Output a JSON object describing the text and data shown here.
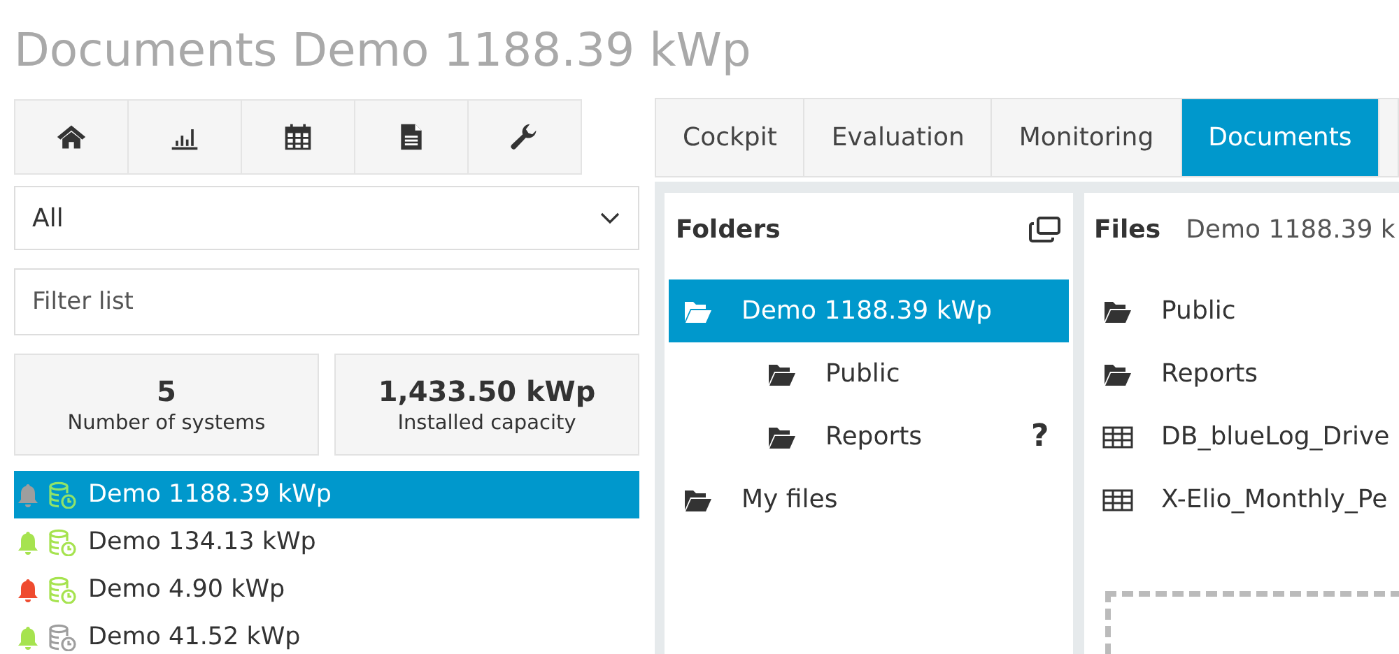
{
  "page_title": "Documents Demo 1188.39 kWp",
  "toolbar": [
    {
      "kind": "home",
      "selected": false
    },
    {
      "kind": "chart",
      "selected": false
    },
    {
      "kind": "calendar",
      "selected": false
    },
    {
      "kind": "document",
      "selected": false
    },
    {
      "kind": "wrench",
      "selected": false
    }
  ],
  "filter_select": {
    "value": "All"
  },
  "filter_input": {
    "placeholder": "Filter list"
  },
  "stats": [
    {
      "value": "5",
      "label": "Number of systems"
    },
    {
      "value": "1,433.50 kWp",
      "label": "Installed capacity"
    }
  ],
  "systems": [
    {
      "name": "Demo 1188.39 kWp",
      "selected": true,
      "alarm": {
        "color": "#9e9e9e"
      },
      "data": {
        "color": "#8fe36a"
      }
    },
    {
      "name": "Demo 134.13 kWp",
      "selected": false,
      "alarm": {
        "color": "#a6e34f"
      },
      "data": {
        "color": "#a6e34f"
      }
    },
    {
      "name": "Demo 4.90 kWp",
      "selected": false,
      "alarm": {
        "color": "#ef4b2f"
      },
      "data": {
        "color": "#a6e34f"
      }
    },
    {
      "name": "Demo 41.52 kWp",
      "selected": false,
      "alarm": {
        "color": "#a6e34f"
      },
      "data": {
        "color": "#9e9e9e"
      }
    }
  ],
  "tabs": [
    {
      "label": "Cockpit",
      "selected": false
    },
    {
      "label": "Evaluation",
      "selected": false
    },
    {
      "label": "Monitoring",
      "selected": false
    },
    {
      "label": "Documents",
      "selected": true
    }
  ],
  "folders": {
    "title": "Folders",
    "tree": [
      {
        "label": "Demo 1188.39 kWp",
        "selected": true,
        "children": [
          {
            "label": "Public",
            "selected": false
          },
          {
            "label": "Reports",
            "selected": false,
            "help": "?"
          }
        ]
      },
      {
        "label": "My files",
        "selected": false
      }
    ]
  },
  "files": {
    "title": "Files",
    "path": "Demo 1188.39 k",
    "items": [
      {
        "kind": "folder",
        "name": "Public"
      },
      {
        "kind": "folder",
        "name": "Reports"
      },
      {
        "kind": "table",
        "name": "DB_blueLog_Drive"
      },
      {
        "kind": "table",
        "name": "X-Elio_Monthly_Pe"
      }
    ]
  }
}
